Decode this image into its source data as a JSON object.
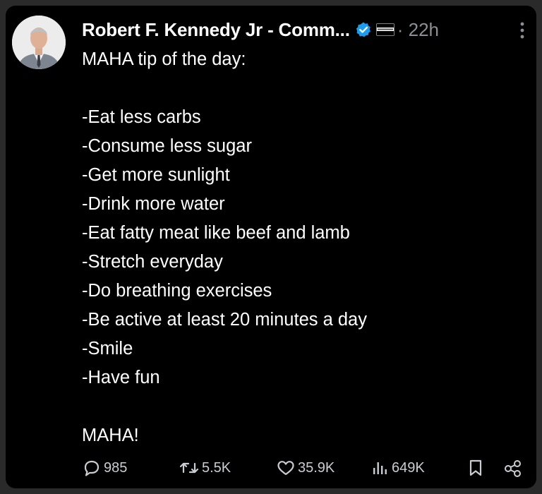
{
  "post": {
    "author": "Robert F. Kennedy Jr - Comm...",
    "timestamp": "22h",
    "separator": "·",
    "title": "MAHA tip of the day:",
    "tips": [
      "-Eat less carbs",
      "-Consume less sugar",
      "-Get more sunlight",
      "-Drink more water",
      "-Eat fatty meat like beef and lamb",
      "-Stretch everyday",
      "-Do breathing exercises",
      "-Be active at least 20 minutes a day",
      "-Smile",
      "-Have fun"
    ],
    "closing": "MAHA!"
  },
  "actions": {
    "replies": "985",
    "reposts": "5.5K",
    "likes": "35.9K",
    "views": "649K"
  },
  "icons": {
    "verified": "verified-badge-icon",
    "flag": "affiliation-flag-icon",
    "more": "more-options-icon",
    "reply": "reply-icon",
    "repost": "repost-icon",
    "like": "heart-icon",
    "views": "views-chart-icon",
    "bookmark": "bookmark-icon",
    "share": "share-icon"
  },
  "colors": {
    "background": "#000000",
    "text": "#ffffff",
    "muted": "#8b8f94",
    "verified": "#1d9bf0"
  }
}
